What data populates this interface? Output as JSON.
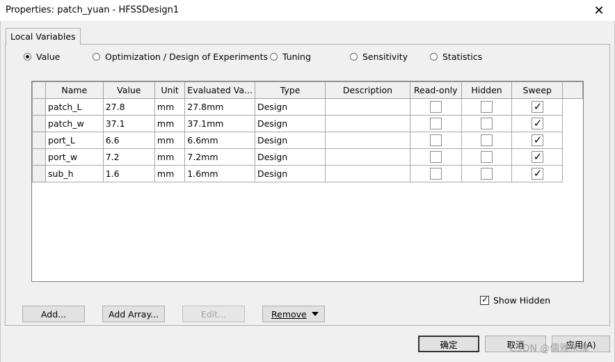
{
  "window": {
    "title": "Properties: patch_yuan - HFSSDesign1",
    "close_glyph": "✕"
  },
  "tabs": [
    {
      "label": "Local Variables",
      "active": true
    }
  ],
  "radio_options": [
    {
      "label": "Value",
      "checked": true
    },
    {
      "label": "Optimization / Design of Experiments",
      "checked": false
    },
    {
      "label": "Tuning",
      "checked": false
    },
    {
      "label": "Sensitivity",
      "checked": false
    },
    {
      "label": "Statistics",
      "checked": false
    }
  ],
  "grid": {
    "columns": [
      "Name",
      "Value",
      "Unit",
      "Evaluated Va...",
      "Type",
      "Description",
      "Read-only",
      "Hidden",
      "Sweep"
    ],
    "rows": [
      {
        "name": "patch_L",
        "value": "27.8",
        "unit": "mm",
        "evaluated": "27.8mm",
        "type": "Design",
        "description": "",
        "read_only": false,
        "hidden": false,
        "sweep": true
      },
      {
        "name": "patch_w",
        "value": "37.1",
        "unit": "mm",
        "evaluated": "37.1mm",
        "type": "Design",
        "description": "",
        "read_only": false,
        "hidden": false,
        "sweep": true
      },
      {
        "name": "port_L",
        "value": "6.6",
        "unit": "mm",
        "evaluated": "6.6mm",
        "type": "Design",
        "description": "",
        "read_only": false,
        "hidden": false,
        "sweep": true
      },
      {
        "name": "port_w",
        "value": "7.2",
        "unit": "mm",
        "evaluated": "7.2mm",
        "type": "Design",
        "description": "",
        "read_only": false,
        "hidden": false,
        "sweep": true
      },
      {
        "name": "sub_h",
        "value": "1.6",
        "unit": "mm",
        "evaluated": "1.6mm",
        "type": "Design",
        "description": "",
        "read_only": false,
        "hidden": false,
        "sweep": true
      }
    ]
  },
  "show_hidden": {
    "label": "Show Hidden",
    "checked": true
  },
  "buttons": {
    "add": "Add...",
    "add_array": "Add Array...",
    "edit": "Edit...",
    "remove": "Remove",
    "ok": "确定",
    "cancel": "取消",
    "apply": "应用(A)"
  },
  "watermark": "CSDN @儒雅永缘"
}
